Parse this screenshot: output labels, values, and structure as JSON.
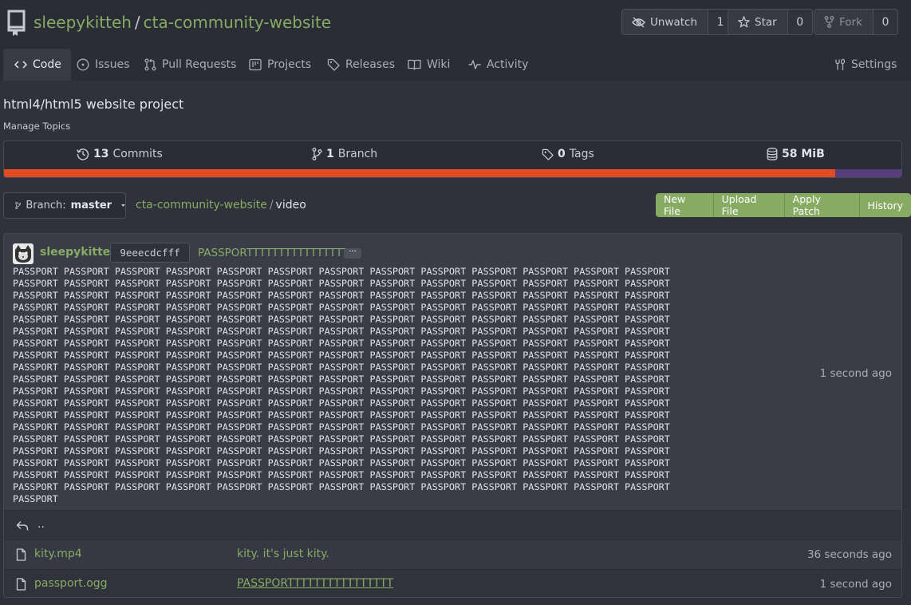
{
  "repo": {
    "owner": "sleepykitteh",
    "separator": "/",
    "name": "cta-community-website"
  },
  "header_buttons": {
    "unwatch": {
      "label": "Unwatch",
      "count": "1"
    },
    "star": {
      "label": "Star",
      "count": "0"
    },
    "fork": {
      "label": "Fork",
      "count": "0"
    }
  },
  "tabs": {
    "code": "Code",
    "issues": "Issues",
    "pull_requests": "Pull Requests",
    "projects": "Projects",
    "releases": "Releases",
    "wiki": "Wiki",
    "activity": "Activity",
    "settings": "Settings"
  },
  "description": "html4/html5 website project",
  "manage_topics": "Manage Topics",
  "stats": {
    "commits": {
      "count": "13",
      "label": "Commits"
    },
    "branches": {
      "count": "1",
      "label": "Branch"
    },
    "tags": {
      "count": "0",
      "label": "Tags"
    },
    "size": {
      "value": "58 MiB"
    }
  },
  "language_bar": [
    {
      "color": "#e44b23",
      "fraction": 0.926
    },
    {
      "color": "#563d7c",
      "fraction": 0.074
    }
  ],
  "branch": {
    "prefix": "Branch:",
    "name": "master"
  },
  "breadcrumb": {
    "root": "cta-community-website",
    "separator": "/",
    "current": "video"
  },
  "actions": {
    "new_file": "New File",
    "upload_file": "Upload File",
    "apply_patch": "Apply Patch",
    "history": "History"
  },
  "latest_commit": {
    "author": "sleepykitteh",
    "sha": "9eeecdcfff",
    "title": "PASSPORTTTTTTTTTTTTTTTT",
    "more": "···",
    "body_word": "PASSPORT",
    "body_word_count": 248,
    "time": "1 second ago"
  },
  "parent_dir": "..",
  "files": [
    {
      "name": "kity.mp4",
      "message": "kity. it's just kity.",
      "time": "36 seconds ago"
    },
    {
      "name": "passport.ogg",
      "message": "PASSPORTTTTTTTTTTTTTTTT",
      "time": "1 second ago"
    }
  ]
}
